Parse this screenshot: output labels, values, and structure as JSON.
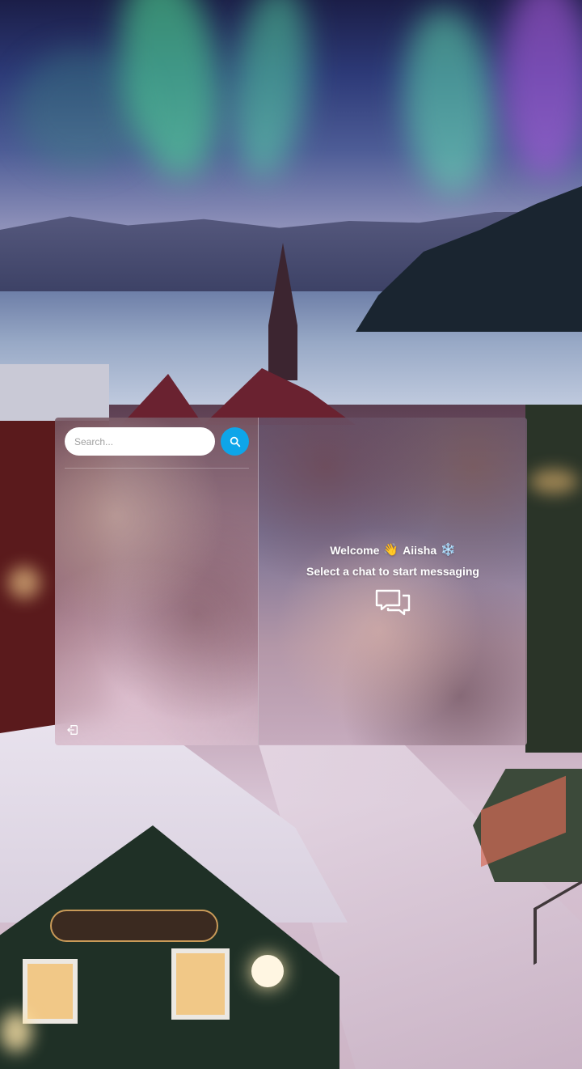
{
  "search": {
    "placeholder": "Search..."
  },
  "welcome": {
    "prefix": "Welcome",
    "wave_emoji": "👋",
    "user_name": "Aiisha",
    "snow_emoji": "❄️",
    "subtitle": "Select a chat to start messaging"
  },
  "icons": {
    "search_button": "search-icon",
    "logout_button": "logout-icon",
    "empty_state": "chat-bubbles-icon"
  },
  "colors": {
    "accent": "#0ea5e9",
    "text": "#ffffff"
  }
}
